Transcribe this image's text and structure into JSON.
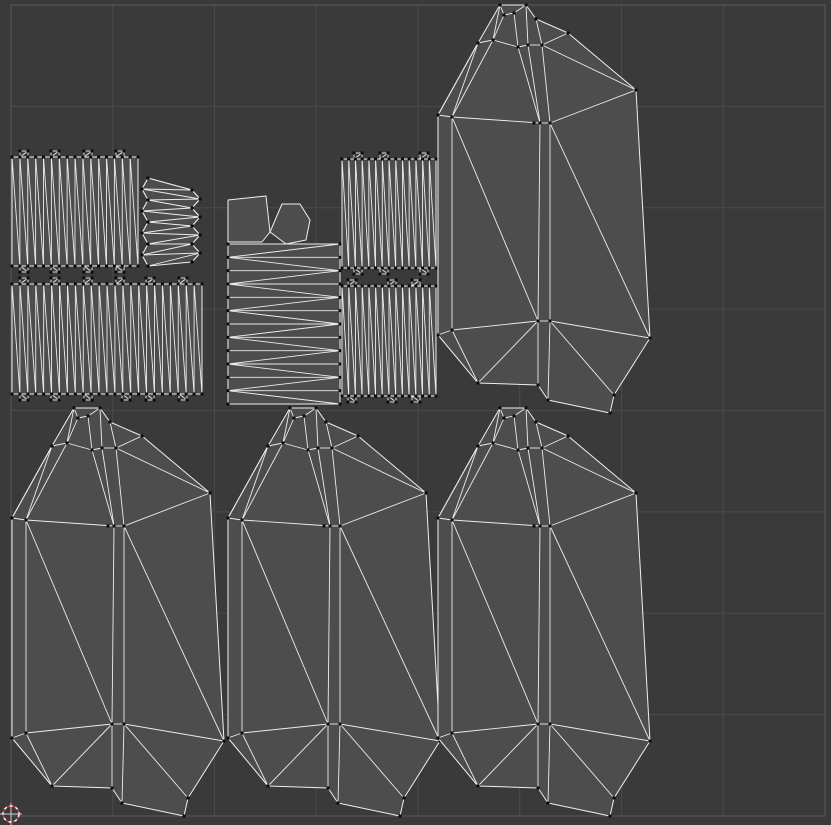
{
  "editor": {
    "mode": "UV Editor",
    "background_color": "#3a3a3a",
    "face_color": "#4d4d4d",
    "edge_color": "#ededed",
    "vertex_color": "#0a0a0a",
    "grid_divisions": 8,
    "cursor_icon": "2d-cursor-icon"
  },
  "islands": [
    {
      "name": "grip-strip-upper-left",
      "kind": "zigzag"
    },
    {
      "name": "grip-strip-lower-left",
      "kind": "zigzag"
    },
    {
      "name": "grip-fan-small",
      "kind": "fan"
    },
    {
      "name": "cap-piece-center",
      "kind": "ladder"
    },
    {
      "name": "grip-strip-upper-mid",
      "kind": "zigzag"
    },
    {
      "name": "grip-strip-lower-mid",
      "kind": "zigzag"
    },
    {
      "name": "blade-top-right",
      "kind": "blade"
    },
    {
      "name": "blade-bottom-left",
      "kind": "blade"
    },
    {
      "name": "blade-bottom-mid",
      "kind": "blade"
    },
    {
      "name": "blade-bottom-right",
      "kind": "blade"
    }
  ]
}
